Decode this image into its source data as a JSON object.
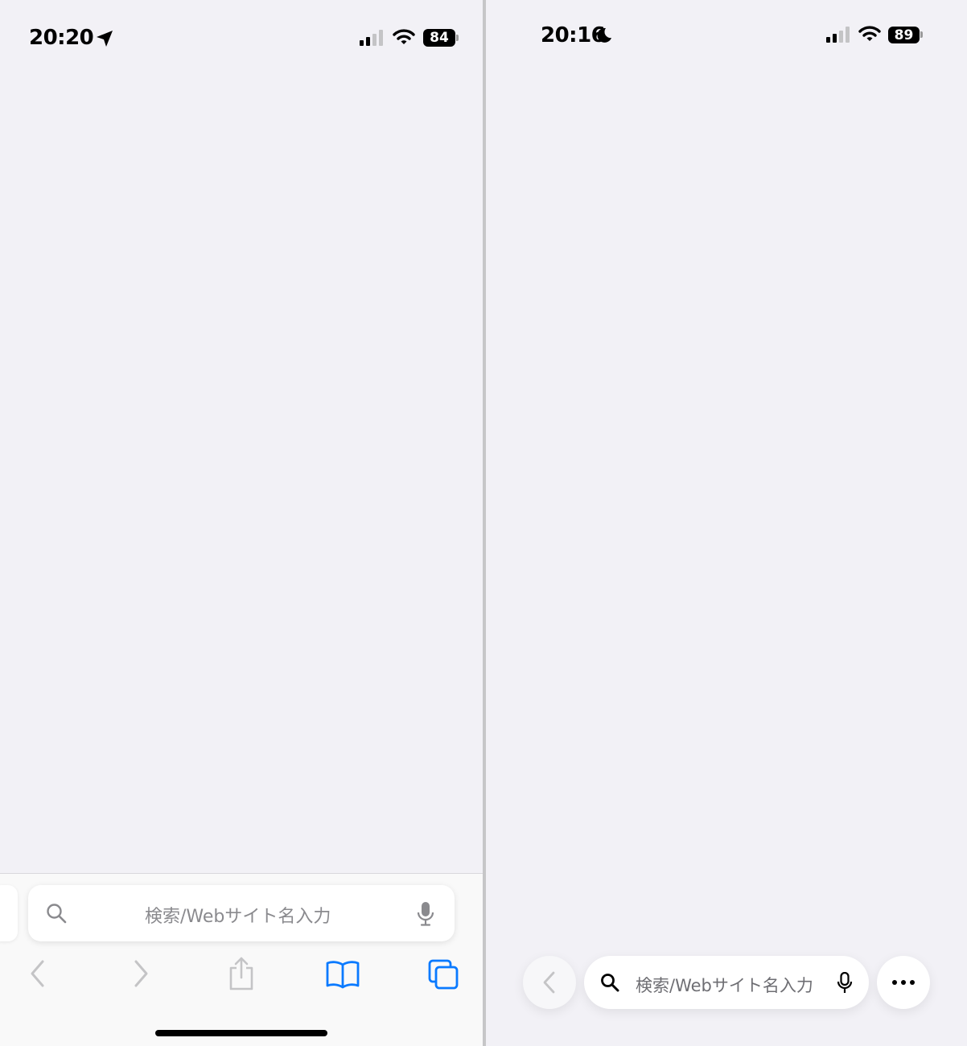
{
  "left": {
    "status_bar": {
      "time": "20:20",
      "battery": "84"
    },
    "search": {
      "placeholder": "検索/Webサイト名入力"
    },
    "toolbar": {
      "icons": [
        "back-icon",
        "forward-icon",
        "share-icon",
        "bookmarks-icon",
        "tabs-icon"
      ]
    },
    "colors": {
      "accent": "#0a7aff",
      "disabled": "#c4c4c6"
    }
  },
  "right": {
    "status_bar": {
      "time": "20:16",
      "battery": "89"
    },
    "search": {
      "placeholder": "検索/Webサイト名入力"
    },
    "toolbar": {
      "icons": [
        "back-icon",
        "search-icon",
        "microphone-icon",
        "more-icon"
      ]
    }
  }
}
